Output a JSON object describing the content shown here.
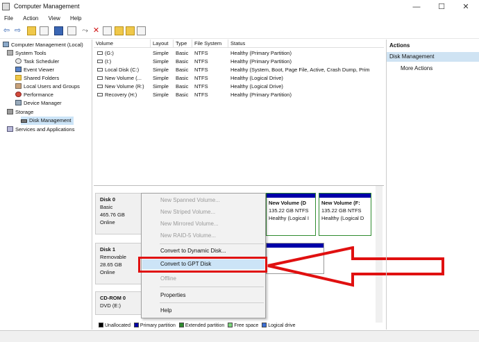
{
  "window": {
    "title": "Computer Management",
    "minimize": "—",
    "maximize": "☐",
    "close": "✕"
  },
  "menu": [
    "File",
    "Action",
    "View",
    "Help"
  ],
  "tree": [
    {
      "label": "Computer Management (Local)",
      "icon": "computer-icon"
    },
    {
      "label": "System Tools",
      "icon": "tools-icon"
    },
    {
      "label": "Task Scheduler",
      "icon": "clock-icon"
    },
    {
      "label": "Event Viewer",
      "icon": "event-icon"
    },
    {
      "label": "Shared Folders",
      "icon": "folder-icon"
    },
    {
      "label": "Local Users and Groups",
      "icon": "users-icon"
    },
    {
      "label": "Performance",
      "icon": "performance-icon"
    },
    {
      "label": "Device Manager",
      "icon": "device-icon"
    },
    {
      "label": "Storage",
      "icon": "storage-icon"
    },
    {
      "label": "Disk Management",
      "icon": "disk-icon"
    },
    {
      "label": "Services and Applications",
      "icon": "services-icon"
    }
  ],
  "columns": [
    "Volume",
    "Layout",
    "Type",
    "File System",
    "Status"
  ],
  "volumes": [
    {
      "volume": "(G:)",
      "layout": "Simple",
      "type": "Basic",
      "fs": "NTFS",
      "status": "Healthy (Primary Partition)"
    },
    {
      "volume": "(I:)",
      "layout": "Simple",
      "type": "Basic",
      "fs": "NTFS",
      "status": "Healthy (Primary Partition)"
    },
    {
      "volume": "Local Disk (C:)",
      "layout": "Simple",
      "type": "Basic",
      "fs": "NTFS",
      "status": "Healthy (System, Boot, Page File, Active, Crash Dump, Prim"
    },
    {
      "volume": "New Volume (...",
      "layout": "Simple",
      "type": "Basic",
      "fs": "NTFS",
      "status": "Healthy (Logical Drive)"
    },
    {
      "volume": "New Volume (R:)",
      "layout": "Simple",
      "type": "Basic",
      "fs": "NTFS",
      "status": "Healthy (Logical Drive)"
    },
    {
      "volume": "Recovery (H:)",
      "layout": "Simple",
      "type": "Basic",
      "fs": "NTFS",
      "status": "Healthy (Primary Partition)"
    }
  ],
  "disks": [
    {
      "name": "Disk 0",
      "type": "Basic",
      "size": "465.76 GB",
      "state": "Online"
    },
    {
      "name": "Disk 1",
      "type": "Removable",
      "size": "28.65 GB",
      "state": "Online"
    },
    {
      "name": "CD-ROM 0",
      "type": "DVD (E:)",
      "size": "",
      "state": ""
    }
  ],
  "partitions": [
    {
      "title": "New Volume (D",
      "size": "135.22 GB NTFS",
      "status": "Healthy (Logical I"
    },
    {
      "title": "New Volume (F:",
      "size": "135.22 GB NTFS",
      "status": "Healthy (Logical D"
    }
  ],
  "context_menu": [
    {
      "label": "New Spanned Volume...",
      "disabled": true
    },
    {
      "label": "New Striped Volume...",
      "disabled": true
    },
    {
      "label": "New Mirrored Volume...",
      "disabled": true
    },
    {
      "label": "New RAID-5 Volume...",
      "disabled": true
    },
    {
      "label": "Convert to Dynamic Disk...",
      "disabled": false
    },
    {
      "label": "Convert to GPT Disk",
      "disabled": false
    },
    {
      "label": "Offline",
      "disabled": true
    },
    {
      "label": "Properties",
      "disabled": false
    },
    {
      "label": "Help",
      "disabled": false
    }
  ],
  "legend": [
    {
      "label": "Unallocated",
      "color": "#000000"
    },
    {
      "label": "Primary partition",
      "color": "#0000a8"
    },
    {
      "label": "Extended partition",
      "color": "#2e8b2e"
    },
    {
      "label": "Free space",
      "color": "#7cd67c"
    },
    {
      "label": "Logical drive",
      "color": "#3b6fd6"
    }
  ],
  "actions": {
    "header": "Actions",
    "section": "Disk Management",
    "more": "More Actions"
  },
  "colors": {
    "highlight": "#cce4f7",
    "annotation": "#e01010"
  }
}
